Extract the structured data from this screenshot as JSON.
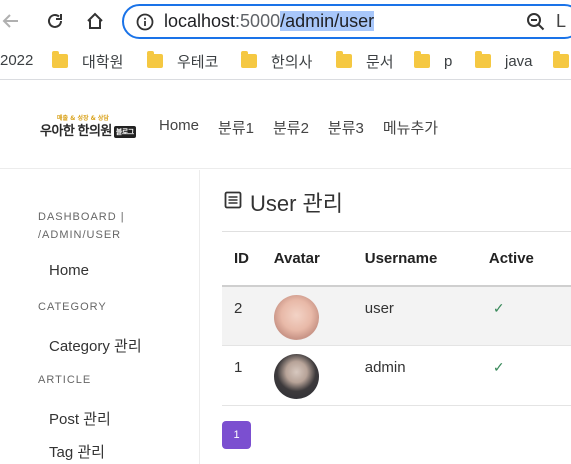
{
  "browser": {
    "address": {
      "host": "localhost",
      "port": ":5000",
      "path": "/admin/user",
      "tail": "L"
    },
    "icons": [
      "back-arrow-icon",
      "reload-icon",
      "home-icon",
      "info-icon",
      "zoom-icon"
    ]
  },
  "bookmarks": {
    "first": "2022",
    "items": [
      "대학원",
      "우테코",
      "한의사",
      "문서",
      "p",
      "java"
    ]
  },
  "header": {
    "logo": {
      "tagline": "매출 & 성장 & 상담",
      "name": "우아한 한의원",
      "badge": "블로그"
    },
    "nav": [
      "Home",
      "분류1",
      "분류2",
      "분류3",
      "메뉴추가"
    ]
  },
  "sidebar": {
    "sections": [
      {
        "heading": "DASHBOARD | /ADMIN/USER",
        "items": [
          "Home"
        ]
      },
      {
        "heading": "CATEGORY",
        "items": [
          "Category 관리"
        ]
      },
      {
        "heading": "ARTICLE",
        "items": [
          "Post 관리",
          "Tag 관리"
        ]
      }
    ]
  },
  "main": {
    "title": "User 관리",
    "table": {
      "columns": [
        "ID",
        "Avatar",
        "Username",
        "Active"
      ],
      "rows": [
        {
          "id": "2",
          "username": "user",
          "active": "✓"
        },
        {
          "id": "1",
          "username": "admin",
          "active": "✓"
        }
      ]
    },
    "pagination": {
      "current": "1"
    }
  },
  "colors": {
    "accent": "#7b4fd0",
    "address_border": "#1a73e8",
    "check": "#3a8a5b",
    "folder": "#f5c842"
  }
}
